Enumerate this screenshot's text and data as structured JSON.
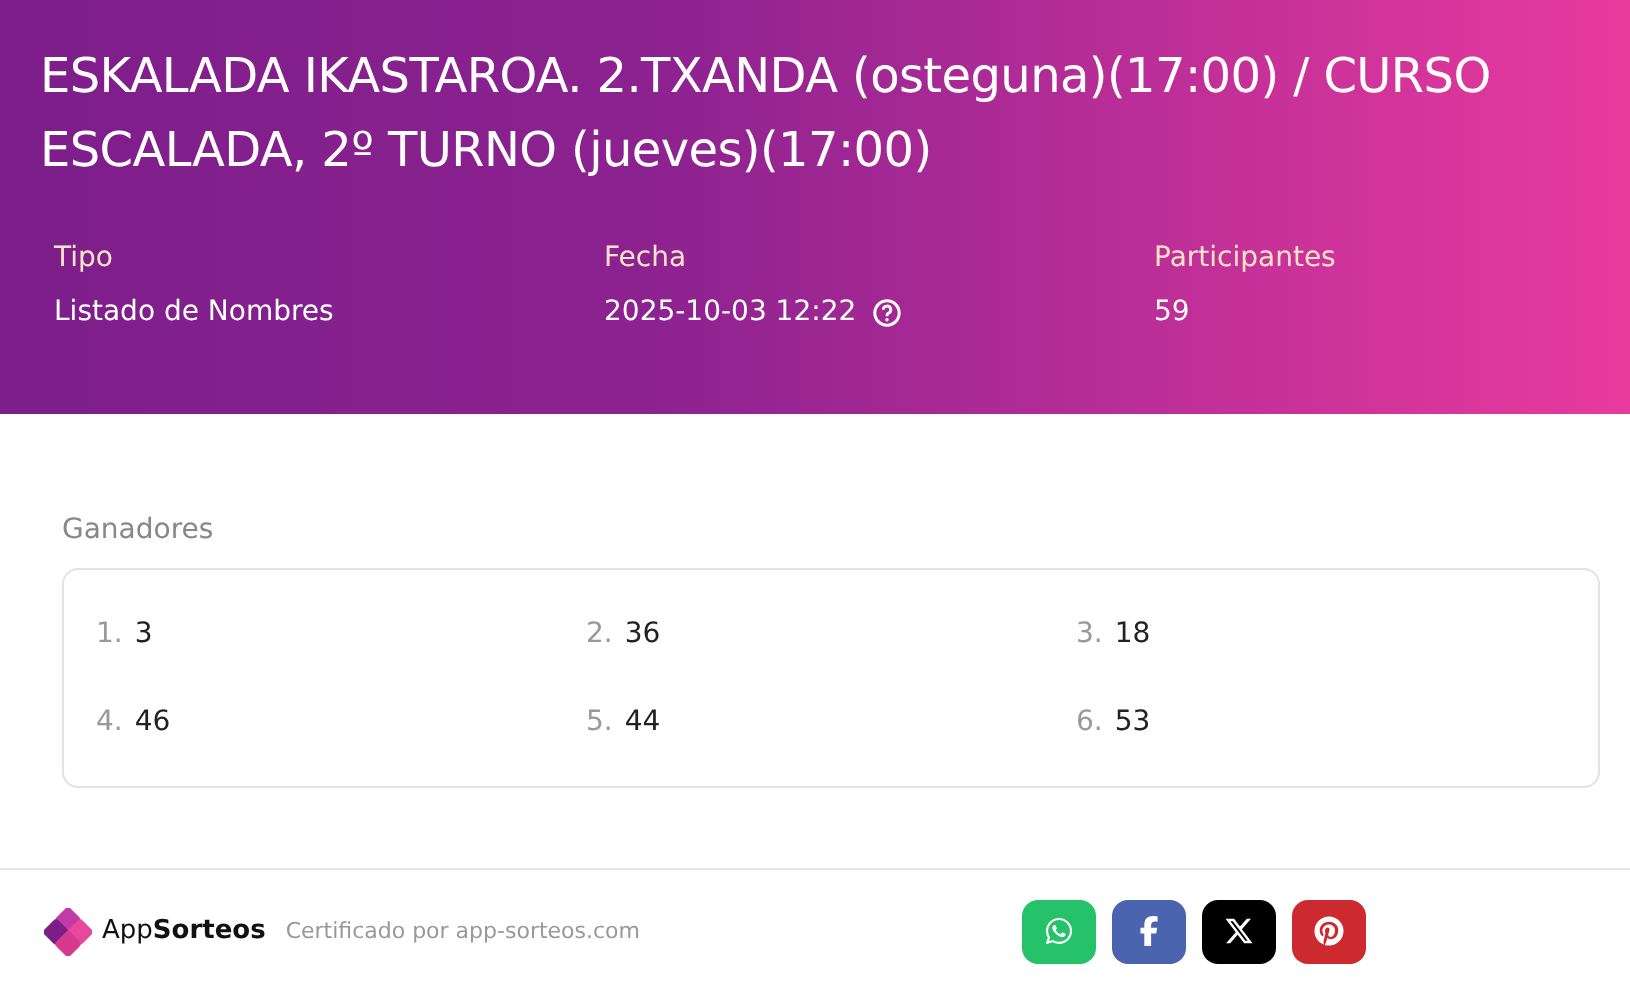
{
  "title": "ESKALADA IKASTAROA. 2.TXANDA (osteguna)(17:00) / CURSO ESCALADA, 2º TURNO (jueves)(17:00)",
  "details": [
    {
      "label": "Tipo",
      "value": "Listado de Nombres",
      "help": false
    },
    {
      "label": "Fecha",
      "value": "2025-10-03 12:22",
      "help": true
    },
    {
      "label": "Participantes",
      "value": "59",
      "help": false
    }
  ],
  "winners": {
    "heading": "Ganadores",
    "items": [
      {
        "rank": "1.",
        "name": "3"
      },
      {
        "rank": "2.",
        "name": "36"
      },
      {
        "rank": "3.",
        "name": "18"
      },
      {
        "rank": "4.",
        "name": "46"
      },
      {
        "rank": "5.",
        "name": "44"
      },
      {
        "rank": "6.",
        "name": "53"
      }
    ]
  },
  "footer": {
    "brand": "App**Sorteos**",
    "certified": "Certificado por app-sorteos.com",
    "share": [
      {
        "kind": "whatsapp",
        "color": "#25c26a"
      },
      {
        "kind": "facebook",
        "color": "#4a64b0"
      },
      {
        "kind": "x",
        "color": "#000000"
      },
      {
        "kind": "pinterest",
        "color": "#cc2a2e"
      }
    ]
  }
}
